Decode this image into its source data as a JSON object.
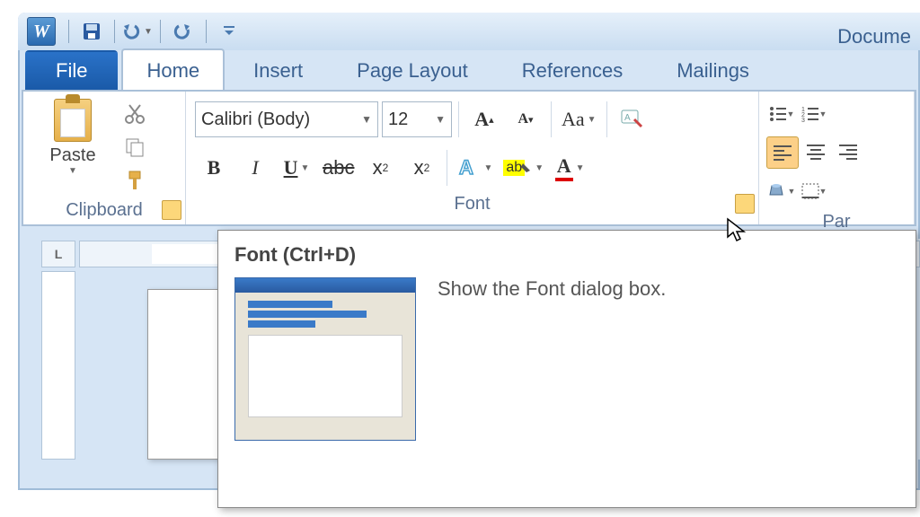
{
  "window": {
    "title": "Docume"
  },
  "tabs": [
    "File",
    "Home",
    "Insert",
    "Page Layout",
    "References",
    "Mailings"
  ],
  "clipboard": {
    "paste": "Paste",
    "label": "Clipboard"
  },
  "font": {
    "family": "Calibri (Body)",
    "size": "12",
    "label": "Font"
  },
  "paragraph": {
    "label": "Par"
  },
  "tooltip": {
    "title": "Font (Ctrl+D)",
    "description": "Show the Font dialog box."
  }
}
